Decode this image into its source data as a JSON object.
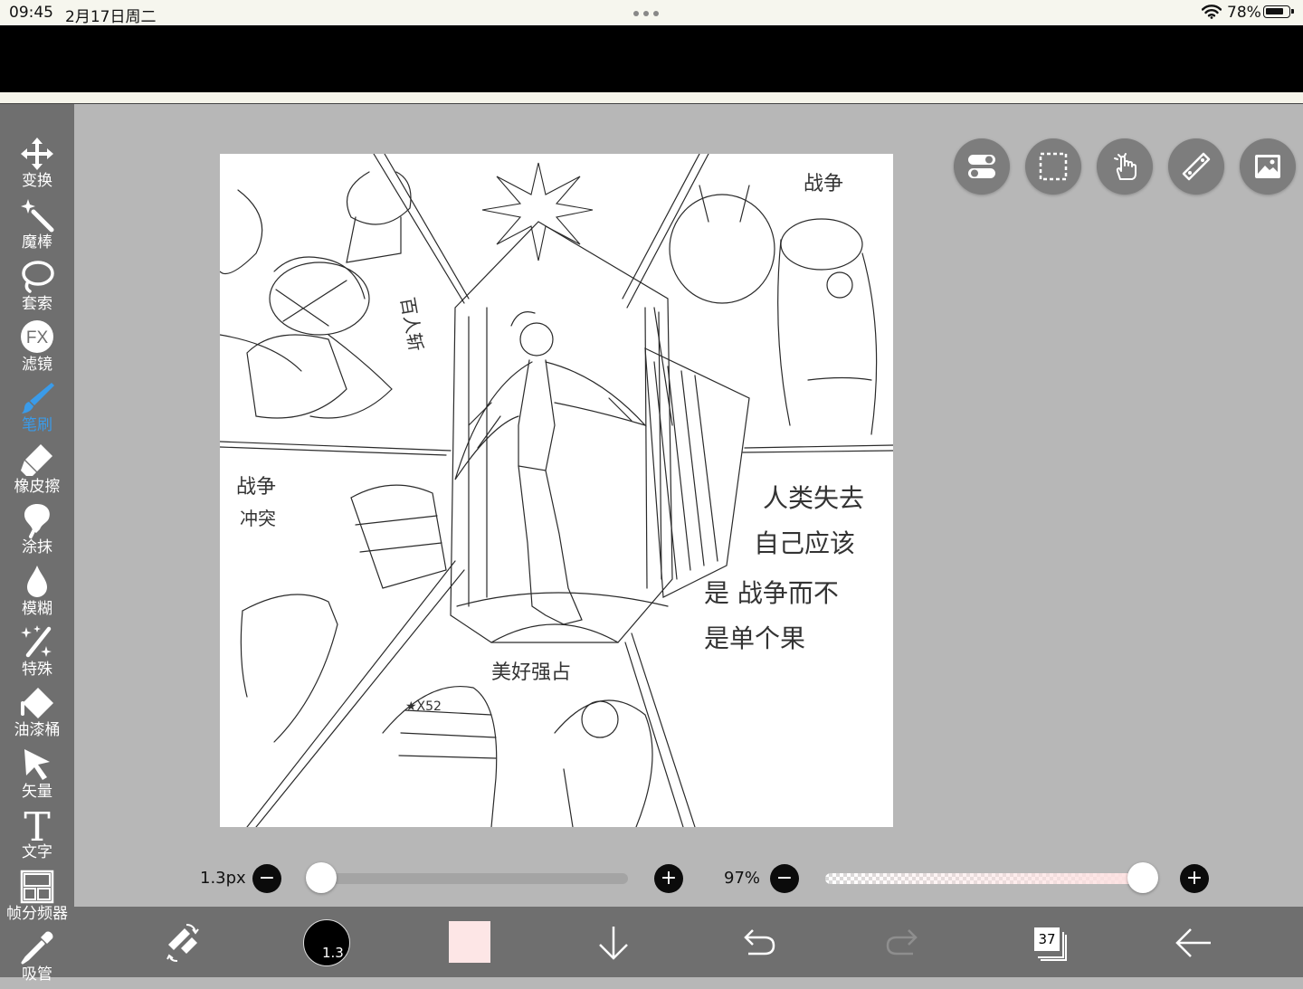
{
  "status_bar": {
    "time": "09:45",
    "date": "2月17日周二",
    "battery": "78%",
    "battery_level": 0.78,
    "icons": [
      "wifi-icon",
      "battery-icon",
      "multitask-dots-icon"
    ]
  },
  "sidebar": {
    "items": [
      {
        "label": "变换",
        "icon": "move-arrows-icon",
        "active": false
      },
      {
        "label": "魔棒",
        "icon": "magic-wand-icon",
        "active": false
      },
      {
        "label": "套索",
        "icon": "lasso-icon",
        "active": false
      },
      {
        "label": "滤镜",
        "icon": "fx-filter-icon",
        "active": false,
        "icon_text": "FX"
      },
      {
        "label": "笔刷",
        "icon": "brush-icon",
        "active": true
      },
      {
        "label": "橡皮擦",
        "icon": "eraser-icon",
        "active": false
      },
      {
        "label": "涂抹",
        "icon": "smudge-icon",
        "active": false
      },
      {
        "label": "模糊",
        "icon": "blur-drop-icon",
        "active": false
      },
      {
        "label": "特殊",
        "icon": "special-sparkle-icon",
        "active": false
      },
      {
        "label": "油漆桶",
        "icon": "paint-bucket-icon",
        "active": false
      },
      {
        "label": "矢量",
        "icon": "vector-cursor-icon",
        "active": false
      },
      {
        "label": "文字",
        "icon": "text-icon",
        "active": false,
        "icon_text": "T"
      },
      {
        "label": "帧分频器",
        "icon": "frame-divider-icon",
        "active": false
      },
      {
        "label": "吸管",
        "icon": "eyedropper-icon",
        "active": false
      }
    ]
  },
  "canvas": {
    "description_icon": "sketch-canvas",
    "text_marks": [
      "战争",
      "百人斩",
      "战争",
      "冲突",
      "人类失去",
      "自己应该",
      "是 战争而不",
      "是单个果",
      "美好强占",
      "★X52"
    ]
  },
  "top_tools": [
    {
      "icon": "toggle-switch-icon"
    },
    {
      "icon": "selection-rect-icon"
    },
    {
      "icon": "hand-gesture-icon"
    },
    {
      "icon": "ruler-icon"
    },
    {
      "icon": "image-reference-icon"
    }
  ],
  "sliders": {
    "size_label": "1.3px",
    "size_value": 1.3,
    "size_fraction": 0.0,
    "opacity_label": "97%",
    "opacity_fraction": 0.97,
    "minus": "−",
    "plus": "+"
  },
  "bottom_bar": {
    "brush_size": "1.3",
    "color": "#fde6e6",
    "layer_count": "37",
    "icons": [
      "swap-colors-icon",
      "brush-preview",
      "color-swatch",
      "download-arrow-icon",
      "undo-icon",
      "redo-icon",
      "layers-icon",
      "back-arrow-icon"
    ]
  },
  "colors": {
    "sidebar_bg": "#6f6f6f",
    "workspace_bg": "#b7b7b7",
    "active_accent": "#3a9be9"
  }
}
